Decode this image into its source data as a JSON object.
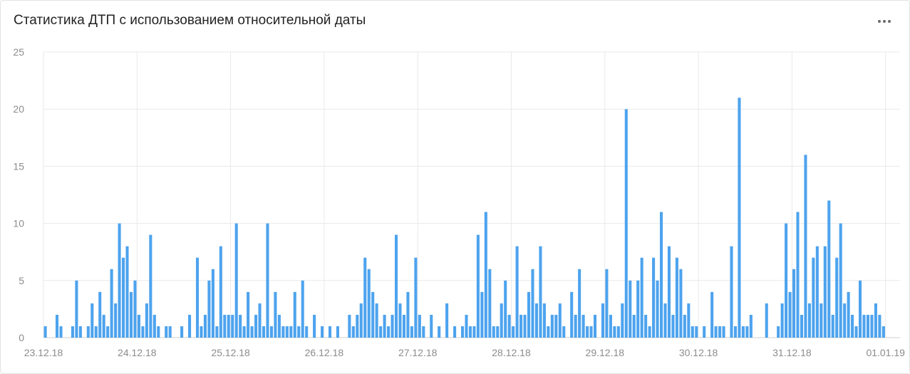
{
  "widget": {
    "title": "Статистика ДТП с использованием относительной даты",
    "menu_icon": "more-dots-icon"
  },
  "chart_data": {
    "type": "bar",
    "title": "Статистика ДТП с использованием относительной даты",
    "xlabel": "",
    "ylabel": "",
    "ylim": [
      0,
      25
    ],
    "y_ticks": [
      "0",
      "5",
      "10",
      "15",
      "20",
      "25"
    ],
    "x_ticks": [
      "23.12.18",
      "24.12.18",
      "25.12.18",
      "26.12.18",
      "27.12.18",
      "28.12.18",
      "29.12.18",
      "30.12.18",
      "31.12.18",
      "01.01.19"
    ],
    "x_unit": "hour",
    "grid": true,
    "bar_color": "#4da3ee",
    "note": "",
    "days": [
      {
        "date": "23.12.18",
        "hourly_values": [
          1,
          0,
          0,
          2,
          1,
          0,
          0,
          1,
          5,
          1,
          0,
          1,
          3,
          1,
          4,
          2,
          1,
          6,
          3,
          10,
          7,
          8,
          4,
          5
        ]
      },
      {
        "date": "24.12.18",
        "hourly_values": [
          2,
          1,
          3,
          9,
          2,
          1,
          0,
          1,
          1,
          0,
          0,
          1,
          0,
          2,
          0,
          7,
          1,
          2,
          5,
          6,
          1,
          8,
          2,
          2
        ]
      },
      {
        "date": "25.12.18",
        "hourly_values": [
          2,
          10,
          2,
          1,
          4,
          1,
          2,
          3,
          1,
          10,
          1,
          4,
          2,
          1,
          1,
          1,
          4,
          1,
          5,
          1,
          0,
          2,
          0,
          1
        ]
      },
      {
        "date": "26.12.18",
        "hourly_values": [
          0,
          1,
          0,
          1,
          0,
          0,
          2,
          1,
          2,
          3,
          7,
          6,
          4,
          3,
          1,
          2,
          1,
          2,
          9,
          3,
          2,
          4,
          1,
          7
        ]
      },
      {
        "date": "27.12.18",
        "hourly_values": [
          2,
          1,
          0,
          2,
          0,
          1,
          0,
          3,
          0,
          1,
          0,
          1,
          2,
          1,
          1,
          9,
          4,
          11,
          6,
          1,
          1,
          3,
          5,
          2
        ]
      },
      {
        "date": "28.12.18",
        "hourly_values": [
          1,
          8,
          2,
          2,
          4,
          6,
          3,
          8,
          3,
          1,
          2,
          2,
          3,
          1,
          0,
          4,
          2,
          6,
          2,
          1,
          1,
          2,
          0,
          3
        ]
      },
      {
        "date": "29.12.18",
        "hourly_values": [
          6,
          2,
          1,
          1,
          3,
          20,
          5,
          2,
          5,
          7,
          2,
          1,
          7,
          5,
          11,
          3,
          8,
          2,
          7,
          6,
          2,
          3,
          1,
          1
        ]
      },
      {
        "date": "30.12.18",
        "hourly_values": [
          0,
          1,
          0,
          4,
          1,
          1,
          1,
          0,
          8,
          1,
          21,
          1,
          1,
          2,
          0,
          0,
          0,
          3,
          0,
          0,
          1,
          3,
          10,
          4
        ]
      },
      {
        "date": "31.12.18",
        "hourly_values": [
          6,
          11,
          2,
          16,
          3,
          7,
          8,
          3,
          8,
          12,
          2,
          7,
          10,
          3,
          4,
          2,
          1,
          5,
          2,
          2,
          2,
          3,
          2,
          1
        ]
      }
    ]
  }
}
